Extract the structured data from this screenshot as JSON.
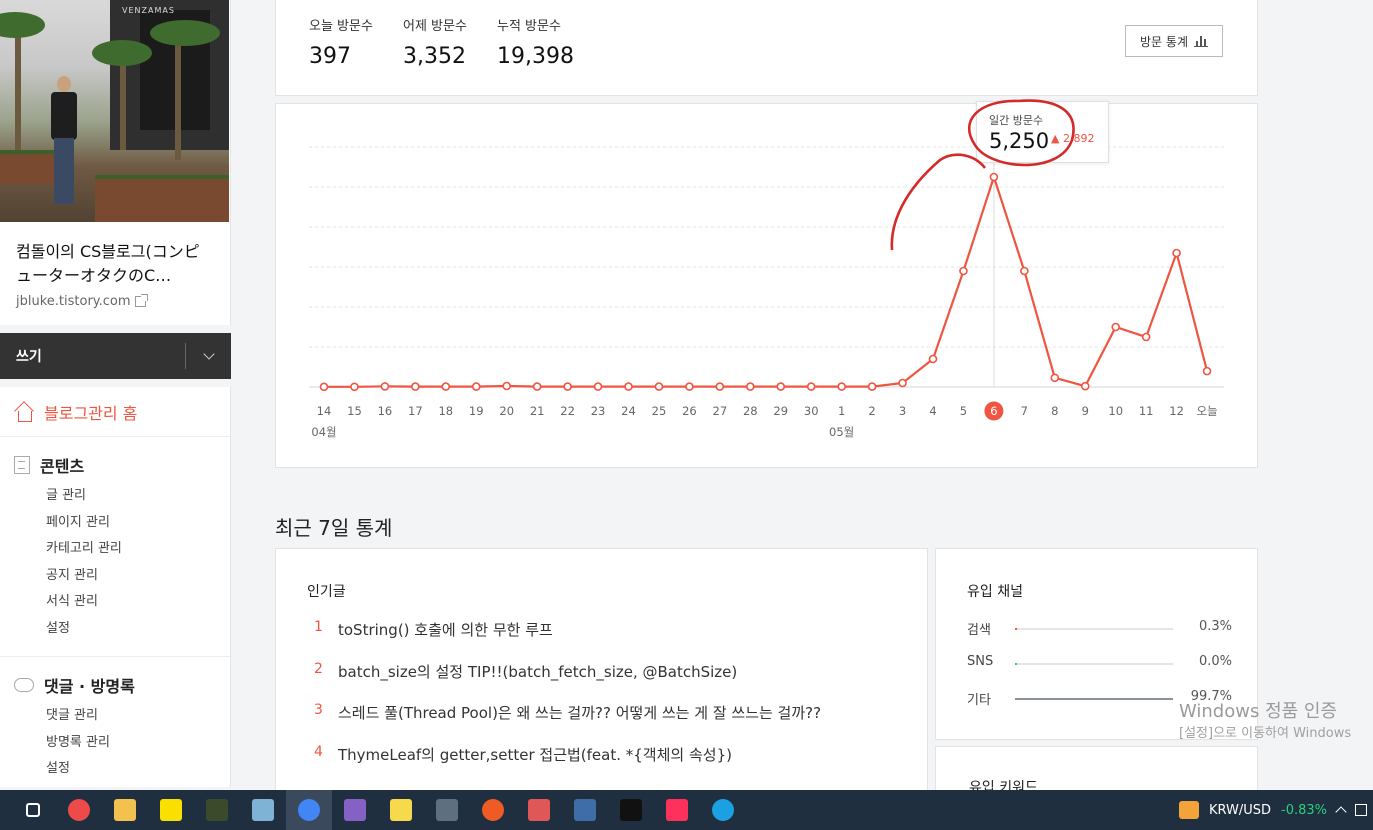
{
  "sidebar": {
    "blog_title": "컴돌이의 CS블로그(コンピューターオタクのC…",
    "blog_url": "jbluke.tistory.com",
    "write_label": "쓰기",
    "home_label": "블로그관리 홈",
    "groups": [
      {
        "title": "콘텐츠",
        "items": [
          "글 관리",
          "페이지 관리",
          "카테고리 관리",
          "공지 관리",
          "서식 관리",
          "설정"
        ]
      },
      {
        "title": "댓글 · 방명록",
        "items": [
          "댓글 관리",
          "방명록 관리",
          "설정"
        ]
      }
    ]
  },
  "stats": {
    "today_label": "오늘 방문수",
    "today_value": "397",
    "yesterday_label": "어제 방문수",
    "yesterday_value": "3,352",
    "total_label": "누적 방문수",
    "total_value": "19,398",
    "button_label": "방문 통계"
  },
  "tooltip": {
    "label": "일간 방문수",
    "value": "5,250",
    "delta": "2,892"
  },
  "chart_data": {
    "type": "line",
    "x": [
      "14",
      "15",
      "16",
      "17",
      "18",
      "19",
      "20",
      "21",
      "22",
      "23",
      "24",
      "25",
      "26",
      "27",
      "28",
      "29",
      "30",
      "1",
      "2",
      "3",
      "4",
      "5",
      "6",
      "7",
      "8",
      "9",
      "10",
      "11",
      "12",
      "오늘"
    ],
    "month_labels": [
      {
        "label": "04월",
        "at": "14"
      },
      {
        "label": "05월",
        "at": "1"
      }
    ],
    "series": [
      {
        "values": [
          5,
          5,
          15,
          10,
          10,
          10,
          25,
          10,
          10,
          10,
          10,
          10,
          10,
          10,
          10,
          10,
          10,
          10,
          10,
          100,
          700,
          2900,
          5250,
          2900,
          230,
          20,
          1500,
          1250,
          3350,
          397
        ]
      }
    ],
    "highlight": "6",
    "ylim": [
      0,
      6000
    ],
    "color": "#ef5541"
  },
  "recent": {
    "title": "최근 7일 통계",
    "popular_title": "인기글",
    "popular": [
      {
        "rank": "1",
        "title": "toString() 호출에 의한 무한 루프"
      },
      {
        "rank": "2",
        "title": "batch_size의 설정 TIP!!(batch_fetch_size, @BatchSize)"
      },
      {
        "rank": "3",
        "title": "스레드 풀(Thread Pool)은 왜 쓰는 걸까?? 어떻게 쓰는 게 잘 쓰느는 걸까??"
      },
      {
        "rank": "4",
        "title": "ThymeLeaf의 getter,setter 접근법(feat. *{객체의 속성})"
      }
    ],
    "channel_title": "유입 채널",
    "channels": [
      {
        "label": "검색",
        "pct": "0.3%",
        "value": 0.3,
        "color": "#ef5541"
      },
      {
        "label": "SNS",
        "pct": "0.0%",
        "value": 0.0,
        "color": "#2ec4b6"
      },
      {
        "label": "기타",
        "pct": "99.7%",
        "value": 99.7,
        "color": "#8a9299"
      }
    ],
    "keyword_title": "유입 키워드"
  },
  "watermark": {
    "line1": "Windows 정품 인증",
    "line2": "[설정]으로 이동하여 Windows"
  },
  "taskbar": {
    "apps": [
      {
        "icon": "task-view-icon",
        "color": "#ffffff"
      },
      {
        "icon": "t-app-icon",
        "color": "#ef4a4a"
      },
      {
        "icon": "folder-icon",
        "color": "#f2c14e"
      },
      {
        "icon": "kakaotalk-icon",
        "color": "#f9e000"
      },
      {
        "icon": "am-app-icon",
        "color": "#3c4a2c"
      },
      {
        "icon": "notes-icon",
        "color": "#7fb3d5"
      },
      {
        "icon": "chrome-icon",
        "color": "#4285f4"
      },
      {
        "icon": "visual-studio-icon",
        "color": "#8661c5"
      },
      {
        "icon": "sticky-notes-icon",
        "color": "#f7d94c"
      },
      {
        "icon": "calculator-icon",
        "color": "#5e6f80"
      },
      {
        "icon": "postman-icon",
        "color": "#ef5b25"
      },
      {
        "icon": "snipping-icon",
        "color": "#e05757"
      },
      {
        "icon": "mysql-workbench-icon",
        "color": "#3e6da8"
      },
      {
        "icon": "terminal-icon",
        "color": "#111111"
      },
      {
        "icon": "intellij-icon",
        "color": "#fe315d"
      },
      {
        "icon": "edge-icon",
        "color": "#1ba0e1"
      }
    ],
    "ticker": "KRW/USD",
    "ticker_change": "-0.83%"
  }
}
